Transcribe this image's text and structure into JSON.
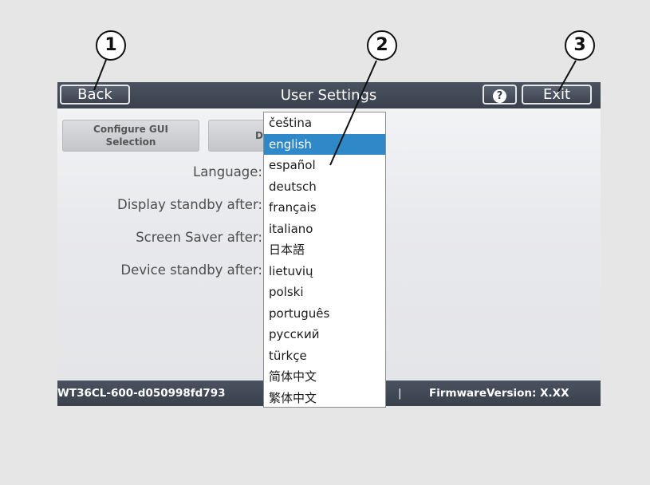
{
  "header": {
    "back_label": "Back",
    "title": "User Settings",
    "help_label": "?",
    "exit_label": "Exit"
  },
  "tabs": [
    {
      "label": "Configure GUI\nSelection"
    },
    {
      "label": "D"
    }
  ],
  "settings": {
    "language_label": "Language:",
    "display_standby_label": "Display standby after:",
    "screen_saver_label": "Screen Saver after:",
    "device_standby_label": "Device standby after:"
  },
  "language_options": [
    "čeština",
    "english",
    "español",
    "deutsch",
    "français",
    "italiano",
    "日本語",
    "lietuvių",
    "polski",
    "português",
    "русский",
    "türkçe",
    "简体中文",
    "繁体中文"
  ],
  "selected_language": "english",
  "footer": {
    "device_id": "WT36CL-600-d050998fd793",
    "separator": "|",
    "firmware": "FirmwareVersion: X.XX"
  },
  "callouts": [
    "1",
    "2",
    "3"
  ],
  "colors": {
    "bar": "#3f4653",
    "selection": "#2f89c8",
    "background": "#e6e6e6"
  },
  "icons": {
    "help": "question-mark-circle-icon"
  }
}
